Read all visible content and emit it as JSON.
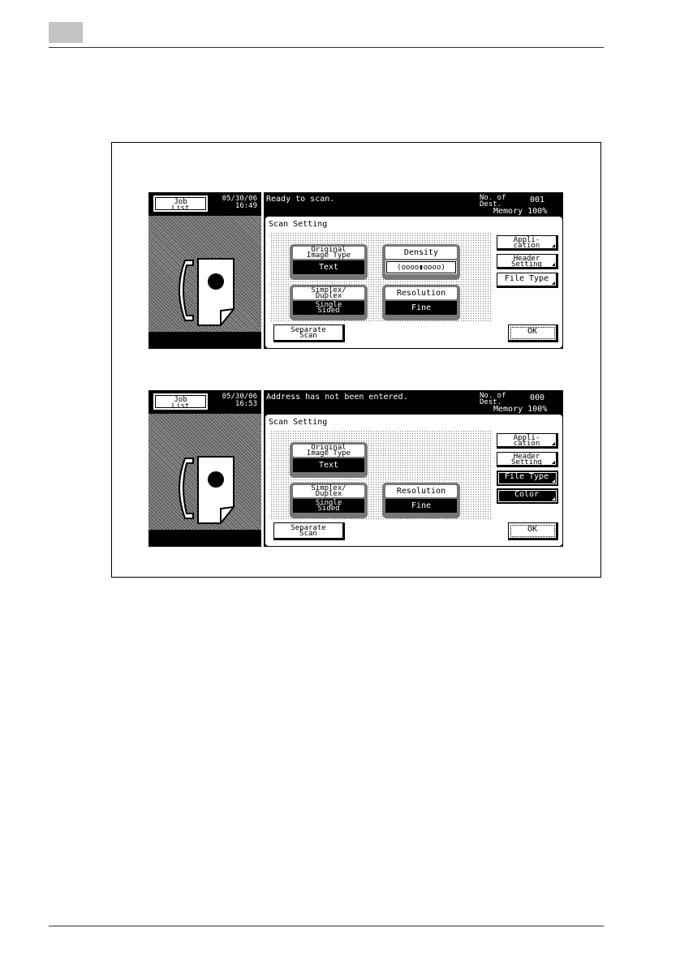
{
  "screen1": {
    "job_list_label": "Job\nList",
    "date": "05/30/06",
    "time": "16:49",
    "status": "Ready to scan.",
    "dest_label": "No. of\nDest.",
    "dest_count": "001",
    "memory": "Memory 100%",
    "scan_setting_title": "Scan Setting",
    "options": {
      "original_image_type_label": "Original\nImage Type",
      "original_image_type_value": "Text",
      "density_label": "Density",
      "density_value": "(oooo▮oooo)",
      "simplex_duplex_label": "Simplex/\nDuplex",
      "simplex_duplex_value": "Single\nSided",
      "resolution_label": "Resolution",
      "resolution_value": "Fine"
    },
    "side_buttons": {
      "application": "Appli-\ncation",
      "header_setting": "Header\nSetting",
      "file_type": "File Type"
    },
    "separate_scan": "Separate\nScan",
    "ok": "OK"
  },
  "screen2": {
    "job_list_label": "Job\nList",
    "date": "05/30/06",
    "time": "16:53",
    "status": "Address has not been entered.",
    "dest_label": "No. of\nDest.",
    "dest_count": "000",
    "memory": "Memory 100%",
    "scan_setting_title": "Scan Setting",
    "options": {
      "original_image_type_label": "Original\nImage Type",
      "original_image_type_value": "Text",
      "simplex_duplex_label": "Simplex/\nDuplex",
      "simplex_duplex_value": "Single\nSided",
      "resolution_label": "Resolution",
      "resolution_value": "Fine"
    },
    "side_buttons": {
      "application": "Appli-\ncation",
      "header_setting": "Header\nSetting",
      "file_type": "File Type",
      "color": "Color"
    },
    "separate_scan": "Separate\nScan",
    "ok": "OK"
  },
  "colors": {
    "chapter_tab": "#c4c4c4",
    "panel_dark": "#000000",
    "pattern": "#8a8a8a"
  },
  "icons": [
    "fax-machine-icon"
  ]
}
